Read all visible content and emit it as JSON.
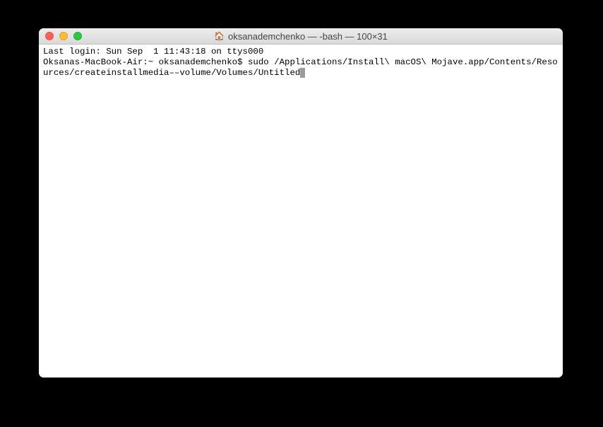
{
  "window": {
    "title": "oksanademchenko — -bash — 100×31"
  },
  "terminal": {
    "last_login": "Last login: Sun Sep  1 11:43:18 on ttys000",
    "prompt": "Oksanas-MacBook-Air:~ oksanademchenko$ ",
    "command": "sudo /Applications/Install\\ macOS\\ Mojave.app/Contents/Resources/createinstallmedia––volume/Volumes/Untitled"
  }
}
